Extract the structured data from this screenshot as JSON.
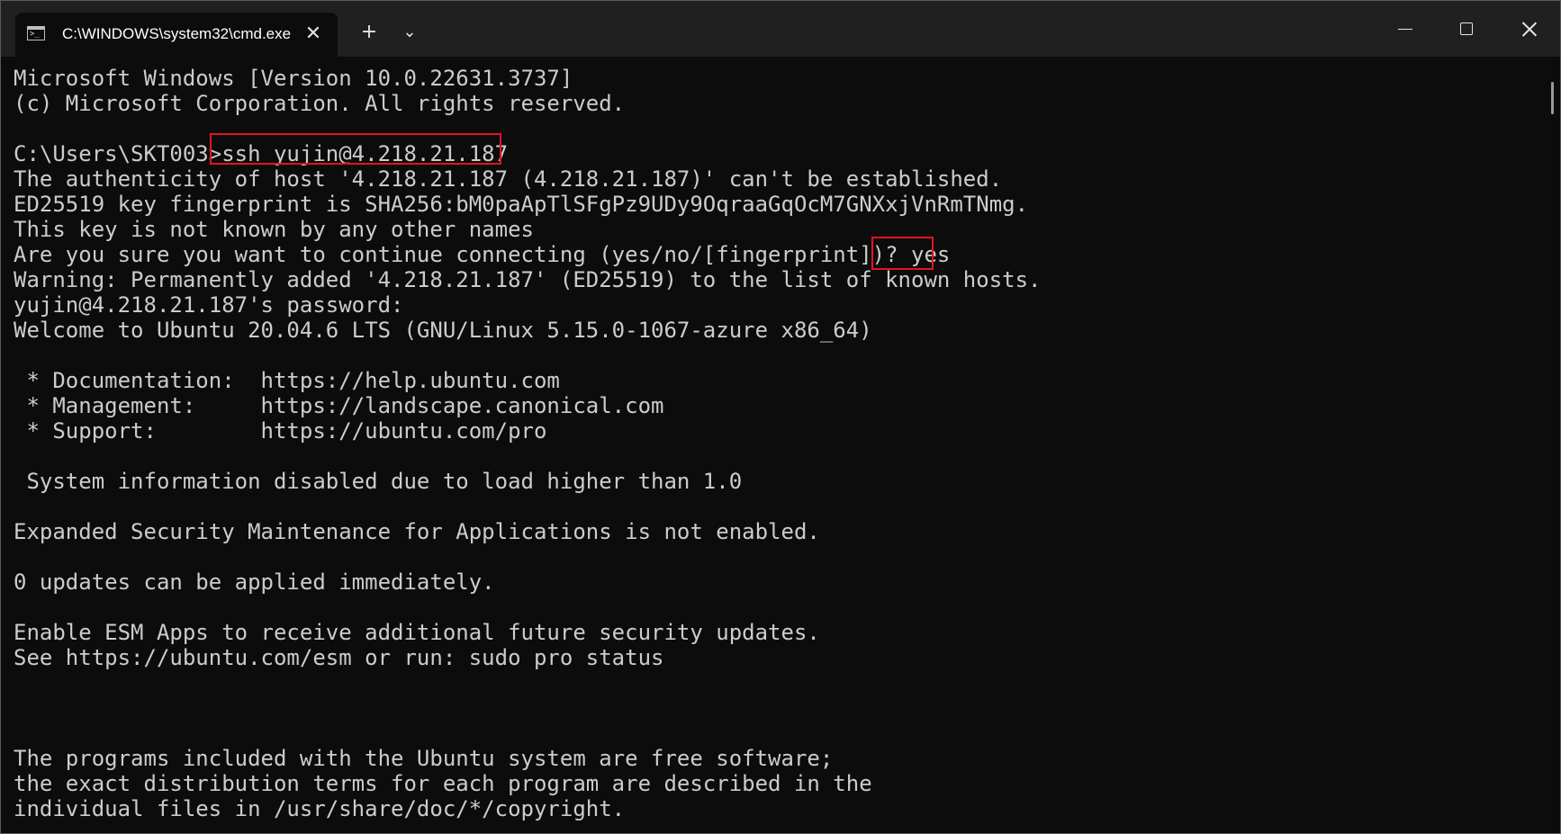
{
  "tab": {
    "icon": "command-prompt-icon",
    "title": "C:\\WINDOWS\\system32\\cmd.exe",
    "close_glyph": "✕"
  },
  "toolbar": {
    "new_tab_glyph": "+",
    "dropdown_glyph": "⌄"
  },
  "window_controls": {
    "minimize": "minimize-icon",
    "maximize": "maximize-icon",
    "close": "close-icon"
  },
  "terminal": {
    "lines": [
      "Microsoft Windows [Version 10.0.22631.3737]",
      "(c) Microsoft Corporation. All rights reserved.",
      "",
      "C:\\Users\\SKT003>ssh yujin@4.218.21.187",
      "The authenticity of host '4.218.21.187 (4.218.21.187)' can't be established.",
      "ED25519 key fingerprint is SHA256:bM0paApTlSFgPz9UDy9OqraaGqOcM7GNXxjVnRmTNmg.",
      "This key is not known by any other names",
      "Are you sure you want to continue connecting (yes/no/[fingerprint])? yes",
      "Warning: Permanently added '4.218.21.187' (ED25519) to the list of known hosts.",
      "yujin@4.218.21.187's password:",
      "Welcome to Ubuntu 20.04.6 LTS (GNU/Linux 5.15.0-1067-azure x86_64)",
      "",
      " * Documentation:  https://help.ubuntu.com",
      " * Management:     https://landscape.canonical.com",
      " * Support:        https://ubuntu.com/pro",
      "",
      " System information disabled due to load higher than 1.0",
      "",
      "Expanded Security Maintenance for Applications is not enabled.",
      "",
      "0 updates can be applied immediately.",
      "",
      "Enable ESM Apps to receive additional future security updates.",
      "See https://ubuntu.com/esm or run: sudo pro status",
      "",
      "",
      "",
      "The programs included with the Ubuntu system are free software;",
      "the exact distribution terms for each program are described in the",
      "individual files in /usr/share/doc/*/copyright."
    ]
  },
  "highlights": {
    "color": "#e81123"
  }
}
